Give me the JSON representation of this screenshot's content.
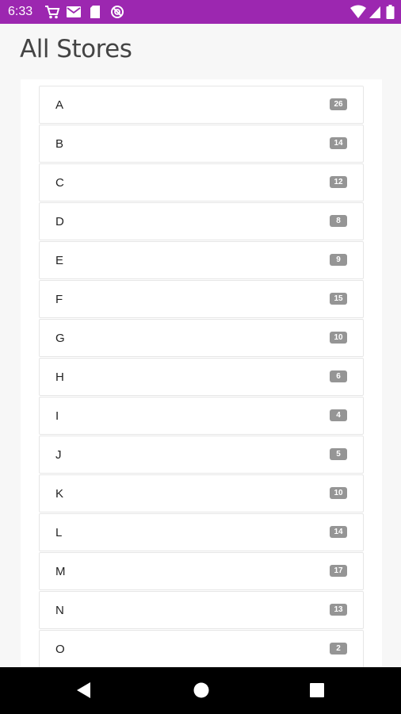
{
  "status_bar": {
    "time": "6:33",
    "icons": [
      "cart-icon",
      "mail-icon",
      "sd-card-icon",
      "block-icon",
      "wifi-icon",
      "signal-icon",
      "battery-icon"
    ],
    "background_color": "#9c27b0"
  },
  "page": {
    "title": "All Stores"
  },
  "stores": [
    {
      "letter": "A",
      "count": "26"
    },
    {
      "letter": "B",
      "count": "14"
    },
    {
      "letter": "C",
      "count": "12"
    },
    {
      "letter": "D",
      "count": "8"
    },
    {
      "letter": "E",
      "count": "9"
    },
    {
      "letter": "F",
      "count": "15"
    },
    {
      "letter": "G",
      "count": "10"
    },
    {
      "letter": "H",
      "count": "6"
    },
    {
      "letter": "I",
      "count": "4"
    },
    {
      "letter": "J",
      "count": "5"
    },
    {
      "letter": "K",
      "count": "10"
    },
    {
      "letter": "L",
      "count": "14"
    },
    {
      "letter": "M",
      "count": "17"
    },
    {
      "letter": "N",
      "count": "13"
    },
    {
      "letter": "O",
      "count": "2"
    }
  ],
  "nav_bar": {
    "buttons": [
      "back-icon",
      "home-icon",
      "recents-icon"
    ]
  }
}
